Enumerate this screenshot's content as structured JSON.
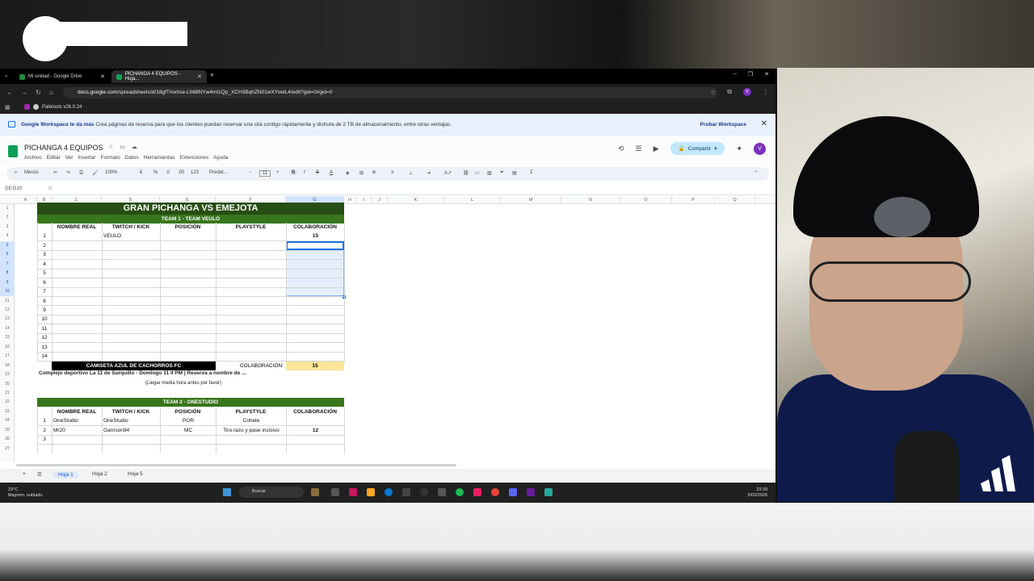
{
  "browser": {
    "tabs": [
      {
        "title": "Mi unidad - Google Drive"
      },
      {
        "title": "PICHANGA 4 EQUIPOS - Hoja..."
      }
    ],
    "url_host": "docs.google.com",
    "url_path": "/spreadsheets/d/18gfTmxhse-Lh68NYw4mt1Qp_XCH3BqhZN01wXYvetL4/edit?gid=0#gid=0",
    "bookmark": "Paletools v26.0.24",
    "profile_initial": "V"
  },
  "banner": {
    "title": "Google Workspace te da más",
    "text": "Crea páginas de reserva para que los clientes puedan reservar una cita contigo rápidamente y disfruta de 2 TB de almacenamiento, entre otras ventajas.",
    "cta": "Probar Workspace"
  },
  "sheet": {
    "title": "PICHANGA 4 EQUIPOS",
    "menu": [
      "Archivo",
      "Editar",
      "Ver",
      "Insertar",
      "Formato",
      "Datos",
      "Herramientas",
      "Extensiones",
      "Ayuda"
    ],
    "share_label": "Compartir",
    "user_initial": "V",
    "toolbar": {
      "menus": "Menús",
      "zoom": "100%",
      "currency": "€",
      "percent": "%",
      "dec_less": ".0",
      "dec_more": ".00",
      "format_123": "123",
      "font": "Predet...",
      "font_size": "11"
    },
    "name_box": "G5:G10",
    "fx": "fx",
    "columns": [
      "A",
      "B",
      "C",
      "D",
      "E",
      "F",
      "G",
      "H",
      "I",
      "J",
      "K",
      "L",
      "M",
      "N",
      "O",
      "P",
      "Q"
    ],
    "rows": [
      "1",
      "2",
      "3",
      "4",
      "5",
      "6",
      "7",
      "8",
      "9",
      "10",
      "11",
      "12",
      "13",
      "14",
      "15",
      "16",
      "17",
      "18",
      "19",
      "20",
      "21",
      "22",
      "23",
      "24",
      "25",
      "26",
      "27"
    ],
    "main_title": "GRAN PICHANGA VS EMEJOTA",
    "team1": {
      "banner": "TEAM 1 - TEAM VEULO",
      "headers": [
        "NOMBRE REAL",
        "TWITCH / KICK",
        "POSICIÓN",
        "PLAYSTYLE",
        "COLABORACIÓN"
      ],
      "rows": [
        {
          "n": "1",
          "nombre": "",
          "twitch": "VEULO",
          "pos": "",
          "style": "",
          "colab": "15"
        },
        {
          "n": "2",
          "nombre": "",
          "twitch": "",
          "pos": "",
          "style": "",
          "colab": ""
        },
        {
          "n": "3",
          "nombre": "",
          "twitch": "",
          "pos": "",
          "style": "",
          "colab": ""
        },
        {
          "n": "4",
          "nombre": "",
          "twitch": "",
          "pos": "",
          "style": "",
          "colab": ""
        },
        {
          "n": "5",
          "nombre": "",
          "twitch": "",
          "pos": "",
          "style": "",
          "colab": ""
        },
        {
          "n": "6",
          "nombre": "",
          "twitch": "",
          "pos": "",
          "style": "",
          "colab": ""
        },
        {
          "n": "7",
          "nombre": "",
          "twitch": "",
          "pos": "",
          "style": "",
          "colab": ""
        },
        {
          "n": "8",
          "nombre": "",
          "twitch": "",
          "pos": "",
          "style": "",
          "colab": ""
        },
        {
          "n": "9",
          "nombre": "",
          "twitch": "",
          "pos": "",
          "style": "",
          "colab": ""
        },
        {
          "n": "10",
          "nombre": "",
          "twitch": "",
          "pos": "",
          "style": "",
          "colab": ""
        },
        {
          "n": "11",
          "nombre": "",
          "twitch": "",
          "pos": "",
          "style": "",
          "colab": ""
        },
        {
          "n": "12",
          "nombre": "",
          "twitch": "",
          "pos": "",
          "style": "",
          "colab": ""
        },
        {
          "n": "13",
          "nombre": "",
          "twitch": "",
          "pos": "",
          "style": "",
          "colab": ""
        },
        {
          "n": "14",
          "nombre": "",
          "twitch": "",
          "pos": "",
          "style": "",
          "colab": ""
        }
      ],
      "camiseta": "CAMISETA AZUL DE CACHORROS FC",
      "colab_label": "COLABORACIÓN:",
      "colab_total": "15",
      "complejo": "Complejo deportivo La 11 de Surquillo - Domingo 11 4 PM | Reserva a nombre de ...",
      "llegar": "(Llegar media hora antes por favor)"
    },
    "team2": {
      "banner": "TEAM 2 - ONESTUDIO",
      "headers": [
        "NOMBRE REAL",
        "TWITCH / KICK",
        "POSICIÓN",
        "PLAYSTYLE",
        "COLABORACIÓN"
      ],
      "rows": [
        {
          "n": "1",
          "nombre": "OneStudio",
          "twitch": "OneStudio",
          "pos": "POR",
          "style": "Cohete",
          "colab": ""
        },
        {
          "n": "2",
          "nombre": "Mr20",
          "twitch": "Garrison94",
          "pos": "MC",
          "style": "Tiro razo y pase incisivo",
          "colab": "12"
        },
        {
          "n": "3",
          "nombre": "",
          "twitch": "",
          "pos": "",
          "style": "",
          "colab": ""
        }
      ]
    },
    "sheet_tabs": [
      "Hoja 1",
      "Hoja 2",
      "Hoja 5"
    ]
  },
  "taskbar": {
    "weather_temp": "23°C",
    "weather_desc": "Mayorm. nublado",
    "search": "Buscar",
    "time": "23:39",
    "date": "5/03/2026"
  },
  "colors": {
    "title_green": "#274e13",
    "team_green": "#38761d",
    "highlight_yellow": "#ffe599",
    "selection_blue": "#1a73e8"
  }
}
